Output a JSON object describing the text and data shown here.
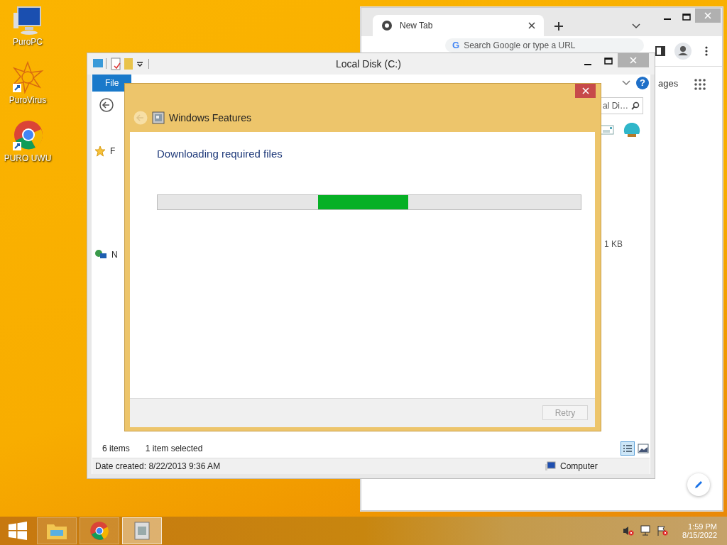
{
  "desktop_icons": [
    {
      "label": "PuroPC",
      "kind": "computer"
    },
    {
      "label": "PuroVirus",
      "kind": "virus"
    },
    {
      "label": "PURO UWU",
      "kind": "chrome"
    }
  ],
  "browser": {
    "tab_title": "New Tab",
    "search_logo": "G",
    "address_placeholder": "Search Google or type a URL",
    "link_partial": "ages"
  },
  "explorer": {
    "title": "Local Disk (C:)",
    "help_glyph": "?",
    "ribbon_tabs": [
      {
        "label": "File",
        "selected": true
      }
    ],
    "search_placeholder": "al Di…",
    "sidebar_items": [
      {
        "label": "F",
        "kind": "favorites"
      },
      {
        "label": "N",
        "kind": "network"
      }
    ],
    "size_cell": "1 KB",
    "item_count": "6 items",
    "selection_count": "1 item selected",
    "details": "Date created: 8/22/2013 9:36 AM",
    "location": "Computer"
  },
  "dialog": {
    "title": "Windows Features",
    "heading": "Downloading required files",
    "progress": {
      "kind": "marquee"
    },
    "retry": {
      "label": "Retry",
      "disabled": true
    }
  },
  "taskbar": {
    "apps": [
      {
        "kind": "explorer",
        "selected": false
      },
      {
        "kind": "chrome",
        "selected": false
      },
      {
        "kind": "features",
        "selected": true
      }
    ],
    "time": "1:59 PM",
    "date": "8/15/2022"
  }
}
